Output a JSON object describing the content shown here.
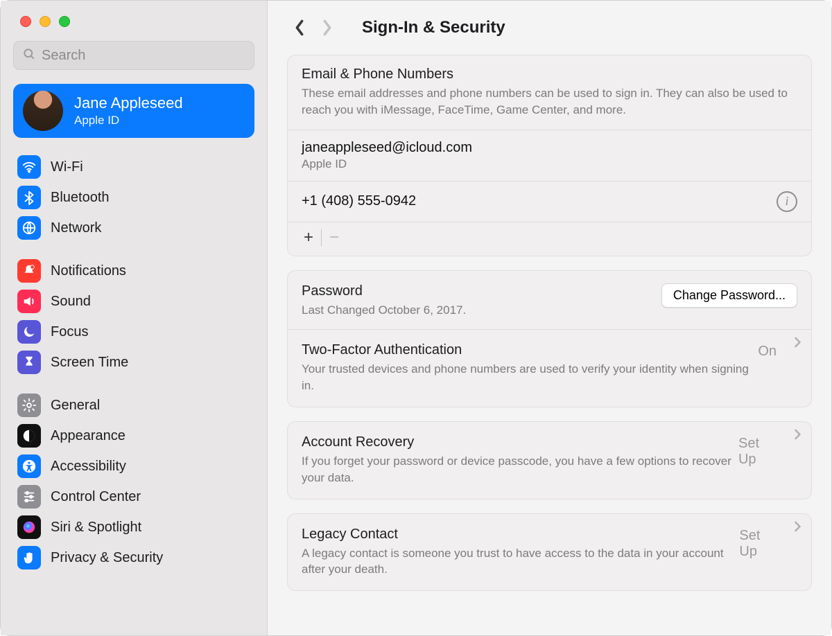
{
  "window": {
    "title": "Sign-In & Security"
  },
  "search": {
    "placeholder": "Search"
  },
  "account": {
    "name": "Jane Appleseed",
    "sub": "Apple ID"
  },
  "sidebar": {
    "groups": [
      {
        "items": [
          {
            "label": "Wi-Fi",
            "icon": "wifi",
            "bg": "#0a7aff"
          },
          {
            "label": "Bluetooth",
            "icon": "bluetooth",
            "bg": "#0a7aff"
          },
          {
            "label": "Network",
            "icon": "globe",
            "bg": "#0a7aff"
          }
        ]
      },
      {
        "items": [
          {
            "label": "Notifications",
            "icon": "bell",
            "bg": "#ff3b30"
          },
          {
            "label": "Sound",
            "icon": "speaker",
            "bg": "#ff2d55"
          },
          {
            "label": "Focus",
            "icon": "moon",
            "bg": "#5856d6"
          },
          {
            "label": "Screen Time",
            "icon": "hourglass",
            "bg": "#5856d6"
          }
        ]
      },
      {
        "items": [
          {
            "label": "General",
            "icon": "gear",
            "bg": "#8e8e93"
          },
          {
            "label": "Appearance",
            "icon": "appearance",
            "bg": "#111111"
          },
          {
            "label": "Accessibility",
            "icon": "access",
            "bg": "#0a7aff"
          },
          {
            "label": "Control Center",
            "icon": "sliders",
            "bg": "#8e8e93"
          },
          {
            "label": "Siri & Spotlight",
            "icon": "siri",
            "bg": "#111111"
          },
          {
            "label": "Privacy & Security",
            "icon": "hand",
            "bg": "#0a7aff"
          }
        ]
      }
    ]
  },
  "emailPhone": {
    "title": "Email & Phone Numbers",
    "desc": "These email addresses and phone numbers can be used to sign in. They can also be used to reach you with iMessage, FaceTime, Game Center, and more.",
    "email": "janeappleseed@icloud.com",
    "emailSub": "Apple ID",
    "phone": "+1 (408) 555-0942"
  },
  "password": {
    "title": "Password",
    "desc": "Last Changed October 6, 2017.",
    "button": "Change Password..."
  },
  "twofa": {
    "title": "Two-Factor Authentication",
    "desc": "Your trusted devices and phone numbers are used to verify your identity when signing in.",
    "status": "On"
  },
  "recovery": {
    "title": "Account Recovery",
    "desc": "If you forget your password or device passcode, you have a few options to recover your data.",
    "status": "Set Up"
  },
  "legacy": {
    "title": "Legacy Contact",
    "desc": "A legacy contact is someone you trust to have access to the data in your account after your death.",
    "status": "Set Up"
  }
}
